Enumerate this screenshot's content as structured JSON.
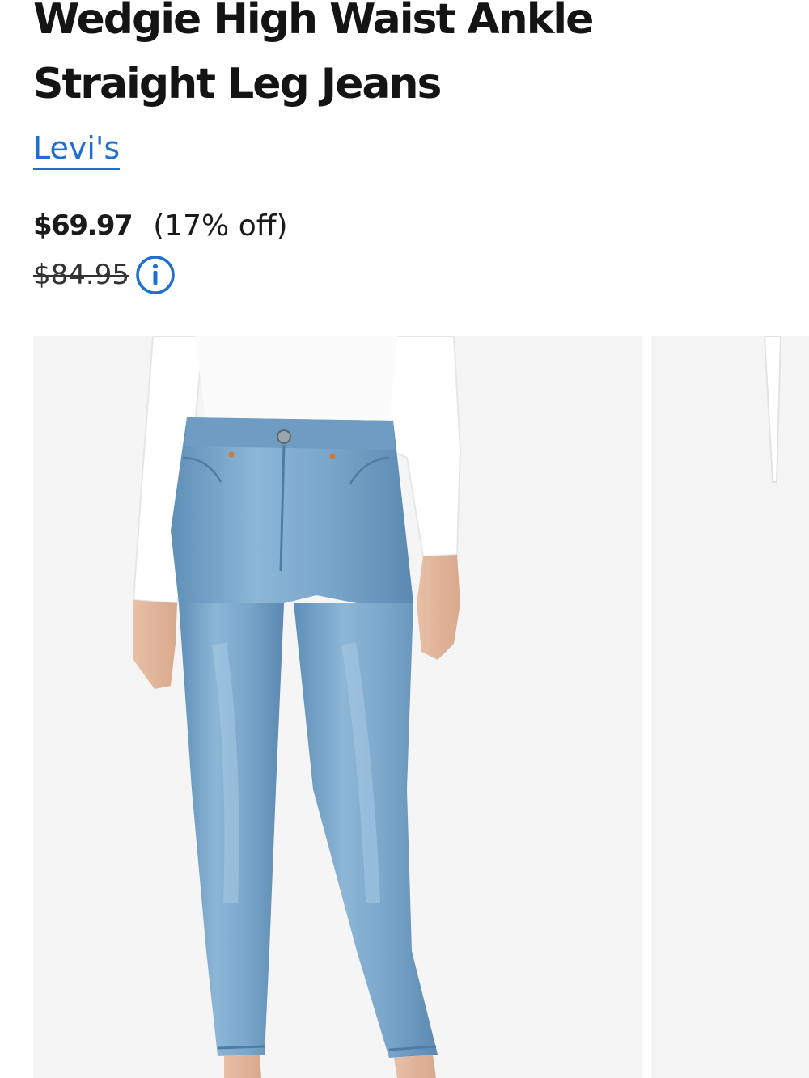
{
  "product": {
    "title": "Wedgie High Waist Ankle Straight Leg Jeans",
    "brand": "Levi's",
    "sale_price": "$69.97",
    "discount": "(17% off)",
    "original_price": "$84.95",
    "info_icon": "info-circle-icon"
  },
  "colors": {
    "brand_link": "#1f6fd1",
    "title_text": "#141414",
    "image_background": "#f5f5f6",
    "denim": "#7aa9cc"
  },
  "gallery": {
    "images": [
      {
        "subject": "model-wearing-light-wash-jeans-front-view"
      },
      {
        "subject": "partially-visible-next-product-image"
      }
    ]
  }
}
